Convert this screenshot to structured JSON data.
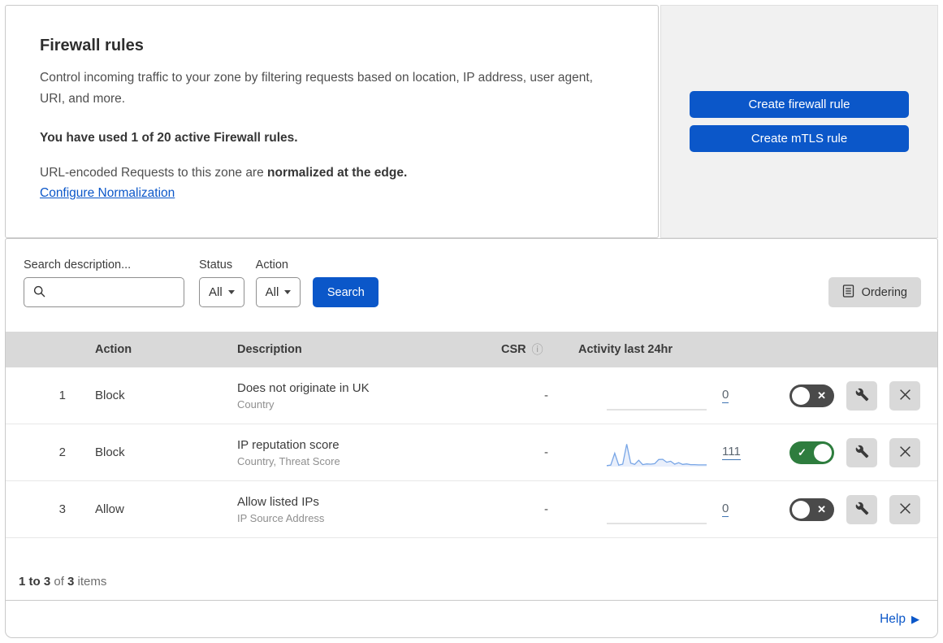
{
  "colors": {
    "accent_blue": "#0b57c9",
    "toggle_on_green": "#2e7d3e",
    "toggle_off_gray": "#4a4a4a",
    "sparkline_blue": "#77a5e6",
    "sparkline_fill": "#e9effb",
    "table_header_bg": "#d9d9d9",
    "panel_bg": "#f1f1f1"
  },
  "icons": {
    "search": "magnifier",
    "ordering": "document-list",
    "info": "ⓘ",
    "caret": "triangle-down",
    "check": "✓",
    "close_small": "✕",
    "wrench": "spanner",
    "help_arrow": "▶"
  },
  "header": {
    "title": "Firewall rules",
    "description": "Control incoming traffic to your zone by filtering requests based on location, IP address, user agent, URI, and more.",
    "usage": "You have used 1 of 20 active Firewall rules.",
    "normalization_prefix": "URL-encoded Requests to this zone are ",
    "normalization_bold": "normalized at the edge.",
    "normalization_link": "Configure Normalization"
  },
  "actions_panel": {
    "create_firewall_rule": "Create firewall rule",
    "create_mtls_rule": "Create mTLS rule"
  },
  "filters": {
    "search_label": "Search description...",
    "search_value": "",
    "status_label": "Status",
    "status_value": "All",
    "action_label": "Action",
    "action_value": "All",
    "search_button": "Search",
    "ordering_button": "Ordering"
  },
  "table": {
    "columns": {
      "action": "Action",
      "description": "Description",
      "csr": "CSR",
      "activity": "Activity last 24hr"
    },
    "rows": [
      {
        "index": "1",
        "action": "Block",
        "description": "Does not originate in UK",
        "fields": "Country",
        "csr": "-",
        "activity_count": "0",
        "enabled": false,
        "sparkline": [
          0,
          0
        ]
      },
      {
        "index": "2",
        "action": "Block",
        "description": "IP reputation score",
        "fields": "Country, Threat Score",
        "csr": "-",
        "activity_count": "111",
        "enabled": true,
        "sparkline": [
          4,
          6,
          55,
          6,
          10,
          92,
          14,
          9,
          26,
          8,
          11,
          10,
          12,
          29,
          30,
          18,
          22,
          10,
          16,
          9,
          11,
          8,
          8,
          7,
          7,
          7
        ]
      },
      {
        "index": "3",
        "action": "Allow",
        "description": "Allow listed IPs",
        "fields": "IP Source Address",
        "csr": "-",
        "activity_count": "0",
        "enabled": false,
        "sparkline": [
          0,
          0
        ]
      }
    ]
  },
  "footer": {
    "range": "1 to 3",
    "of": " of ",
    "total": "3",
    "items": " items"
  },
  "help": {
    "label": "Help"
  }
}
